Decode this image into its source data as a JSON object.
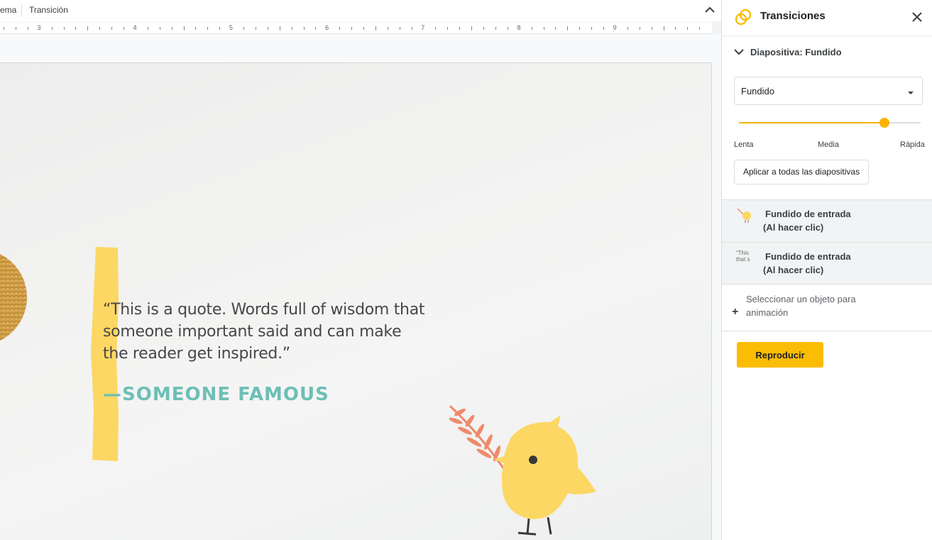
{
  "toolbar": {
    "partial_item": "ema",
    "transition_label": "Transición",
    "collapse_icon": "chevron-up-icon"
  },
  "ruler": {
    "numbers": [
      "3",
      "4",
      "5",
      "6",
      "7",
      "8",
      "9"
    ]
  },
  "slide": {
    "quote": "“This is a quote. Words full of wisdom that someone important said and can make the reader get inspired.”",
    "author": "—SOMEONE FAMOUS",
    "colors": {
      "accent_yellow": "#fdd763",
      "author_teal": "#6dbfb5",
      "leaf": "#f08a6a"
    }
  },
  "panel": {
    "title": "Transiciones",
    "logo_icon": "transitions-rings-icon",
    "close_icon": "close-icon",
    "section_label": "Diapositiva: Fundido",
    "transition_select": {
      "value": "Fundido"
    },
    "speed": {
      "labels": [
        "Lenta",
        "Media",
        "Rápida"
      ],
      "value_fraction": 0.8
    },
    "apply_all_label": "Aplicar a todas las diapositivas",
    "animations": [
      {
        "title": "Fundido de entrada",
        "subtitle": "(Al hacer clic)",
        "thumb": "bird-thumb"
      },
      {
        "title": "Fundido de entrada",
        "subtitle": "(Al hacer clic)",
        "thumb": "quote-text-thumb",
        "thumb_text": "“This that s"
      }
    ],
    "add_animation_label": "Seleccionar un objeto para animación",
    "play_label": "Reproducir",
    "accent_color": "#fbbc04"
  }
}
